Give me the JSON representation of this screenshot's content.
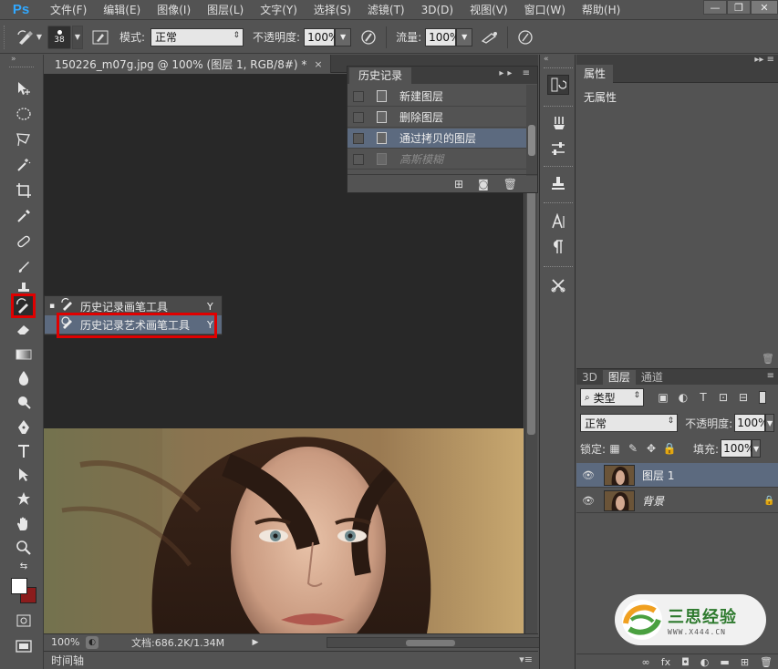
{
  "app": {
    "logo": "Ps"
  },
  "menubar": {
    "items": [
      "文件(F)",
      "编辑(E)",
      "图像(I)",
      "图层(L)",
      "文字(Y)",
      "选择(S)",
      "滤镜(T)",
      "3D(D)",
      "视图(V)",
      "窗口(W)",
      "帮助(H)"
    ],
    "window_controls": [
      "—",
      "❐",
      "✕"
    ]
  },
  "options": {
    "brush_size": "38",
    "mode_label": "模式:",
    "mode_value": "正常",
    "opacity_label": "不透明度:",
    "opacity_value": "100%",
    "flow_label": "流量:",
    "flow_value": "100%"
  },
  "document": {
    "tab_title": "150226_m07g.jpg @ 100% (图层 1, RGB/8#) *",
    "tab_close": "×",
    "zoom": "100%",
    "doc_info": "文档:686.2K/1.34M"
  },
  "flyout": {
    "items": [
      {
        "label": "历史记录画笔工具",
        "shortcut": "Y",
        "bullet": "▪"
      },
      {
        "label": "历史记录艺术画笔工具",
        "shortcut": "Y",
        "bullet": ""
      }
    ]
  },
  "history_panel": {
    "title": "历史记录",
    "items": [
      "新建图层",
      "删除图层",
      "通过拷贝的图层",
      "高斯模糊"
    ]
  },
  "properties_panel": {
    "title": "属性",
    "body": "无属性"
  },
  "layers_panel": {
    "tabs": [
      "3D",
      "图层",
      "通道"
    ],
    "filter_value": "类型",
    "blend_value": "正常",
    "opacity_label": "不透明度:",
    "opacity_value": "100%",
    "lock_label": "锁定:",
    "fill_label": "填充:",
    "fill_value": "100%",
    "layers": [
      {
        "name": "图层 1"
      },
      {
        "name": "背景"
      }
    ]
  },
  "timeline": {
    "label": "时间轴"
  },
  "watermark": {
    "title": "三思经验",
    "url": "WWW.X444.CN"
  },
  "colors": {
    "highlight": "#5c6a7f",
    "annotation_red": "#e00000",
    "background_swatch": "#8b1c1c"
  }
}
